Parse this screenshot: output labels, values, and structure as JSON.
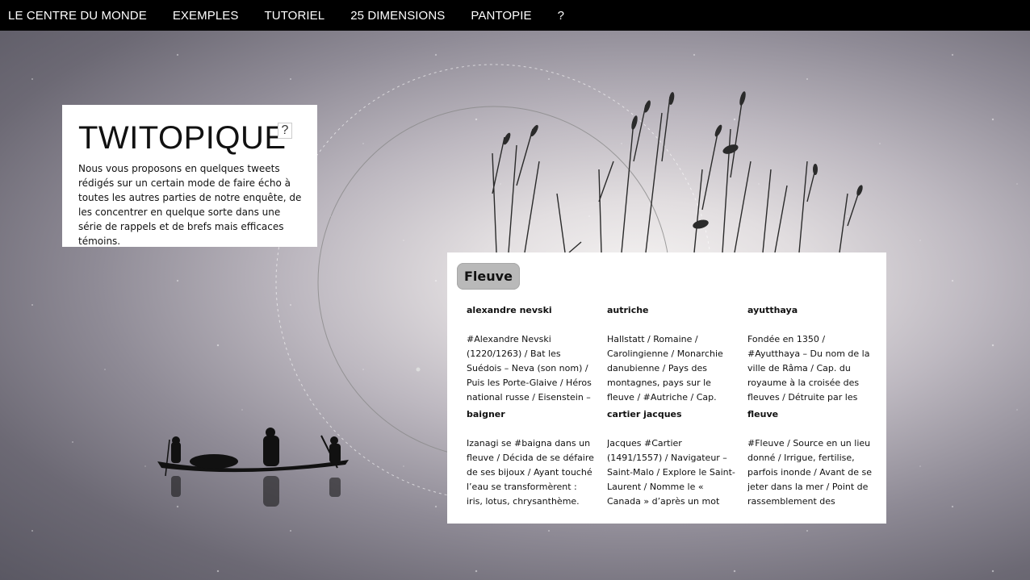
{
  "nav": {
    "items": [
      "LE CENTRE DU MONDE",
      "EXEMPLES",
      "TUTORIEL",
      "25 DIMENSIONS",
      "PANTOPIE",
      "?"
    ]
  },
  "intro": {
    "title": "TWITOPIQUE",
    "help_label": "?",
    "text": "Nous vous proposons en quelques tweets rédigés sur un certain mode de faire écho à toutes les autres parties de notre enquête, de les concentrer en quelque sorte dans une série de rappels et de brefs mais efficaces témoins."
  },
  "panel": {
    "tab": "Fleuve",
    "entries": [
      {
        "title": "alexandre nevski",
        "body": "#Alexandre Nevski (1220/1263) / Bat les Suédois – Neva (son nom) / Puis les Porte-Glaive / Héros national russe / Eisenstein – Prokofiev."
      },
      {
        "title": "autriche",
        "body": "Hallstatt / Romaine / Carolingienne / Monarchie danubienne / Pays des montagnes, pays sur le fleuve / #Autriche / Cap. Vienne."
      },
      {
        "title": "ayutthaya",
        "body": "Fondée en 1350 / #Ayutthaya – Du nom de la ville de Râma / Cap. du royaume à la croisée des fleuves / Détruite par les Birmans."
      },
      {
        "title": "baigner",
        "body": "Izanagi se #baigna dans un fleuve / Décida de se défaire de ses bijoux / Ayant touché l’eau se transformèrent : iris, lotus, chrysanthème."
      },
      {
        "title": "cartier jacques",
        "body": "Jacques #Cartier (1491/1557) / Navigateur – Saint-Malo / Explore le Saint-Laurent / Nomme le « Canada » d’après un mot iroquois."
      },
      {
        "title": "fleuve",
        "body": "#Fleuve / Source en un lieu donné / Irrigue, fertilise, parfois inonde / Avant de se jeter dans la mer / Point de rassemblement des espèces."
      }
    ]
  },
  "colors": {
    "nav_bg": "#000000",
    "tab_bg": "#b9b9b9",
    "panel_bg": "#ffffff"
  }
}
